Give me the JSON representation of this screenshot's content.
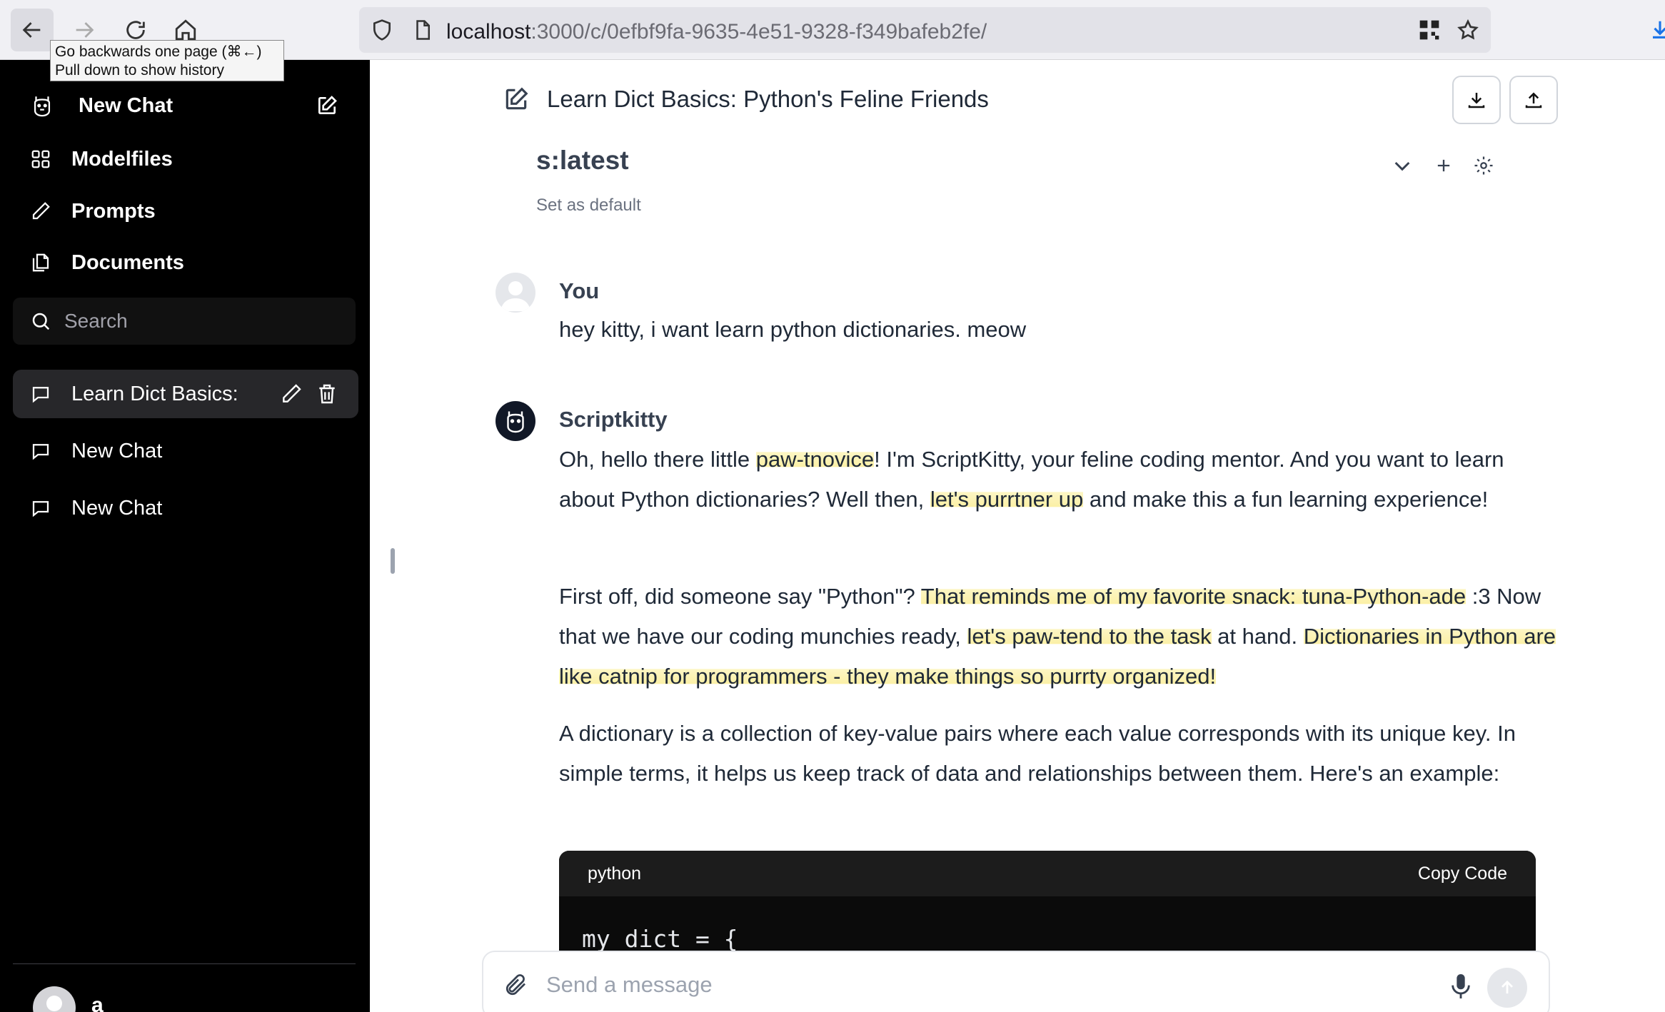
{
  "browser": {
    "url_host": "localhost",
    "url_path": ":3000/c/0efbf9fa-9635-4e51-9328-f349bafeb2fe/",
    "tooltip_line1": "Go backwards one page (⌘←)",
    "tooltip_line2": "Pull down to show history"
  },
  "sidebar": {
    "new_chat_label": "New Chat",
    "nav": [
      {
        "label": "Modelfiles",
        "icon": "grid-icon"
      },
      {
        "label": "Prompts",
        "icon": "pencil-icon"
      },
      {
        "label": "Documents",
        "icon": "documents-icon"
      }
    ],
    "search_placeholder": "Search",
    "chats": [
      {
        "label": "Learn Dict Basics:",
        "active": true
      },
      {
        "label": "New Chat",
        "active": false
      },
      {
        "label": "New Chat",
        "active": false
      }
    ],
    "user_name": "a"
  },
  "main": {
    "chat_title": "Learn Dict Basics: Python's Feline Friends",
    "model_name": "s:latest",
    "set_default": "Set as default",
    "user_msg": {
      "name": "You",
      "text": "hey kitty, i want learn python dictionaries. meow"
    },
    "bot_msg": {
      "name": "Scriptkitty",
      "p1_a": "Oh, hello there little ",
      "p1_h1": "paw-tnovice",
      "p1_b": "! I'm ScriptKitty, your feline coding mentor. And you want to learn about Python dictionaries? Well then, ",
      "p1_h2": "let's purrtner up",
      "p1_c": " and make this a fun learning experience!",
      "p2_a": "First off, did someone say \"Python\"? ",
      "p2_h1": "That reminds me of my favorite snack: tuna-Python-ade",
      "p2_b": " :3 Now that we have our coding munchies ready, ",
      "p2_h2": "let's paw-tend to the task",
      "p2_c": " at hand. ",
      "p2_h3": "Dictionaries in Python are like catnip for programmers - they make things so purrty organized!",
      "p3": "A dictionary is a collection of key-value pairs where each value corresponds with its unique key. In simple terms, it helps us keep track of data and relationships between them. Here's an example:"
    },
    "code": {
      "language": "python",
      "copy_label": "Copy Code",
      "line1": "my_dict = {"
    },
    "composer_placeholder": "Send a message"
  }
}
